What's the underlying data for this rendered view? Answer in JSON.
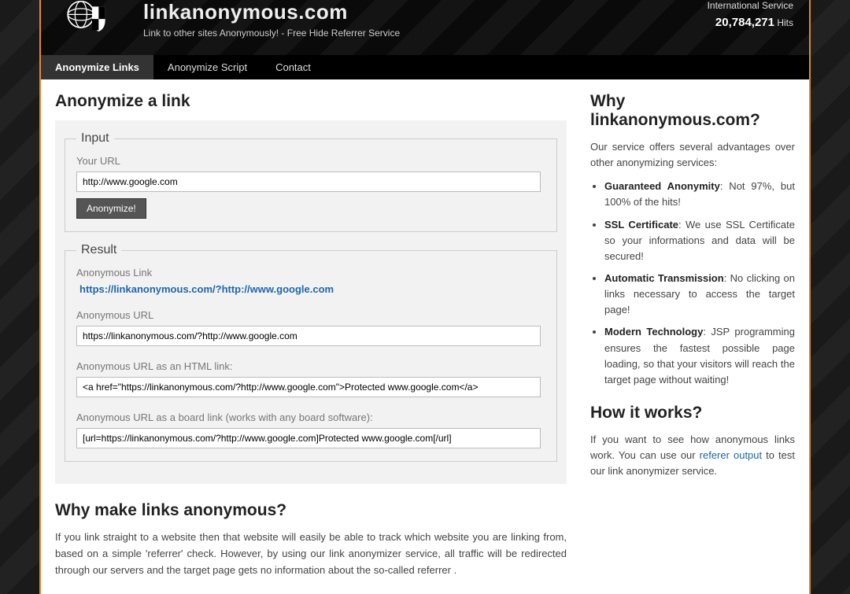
{
  "header": {
    "title": "linkanonymous.com",
    "tagline": "Link to other sites Anonymously! - Free Hide Referrer Service",
    "service_label": "International Service",
    "hits_count": "20,784,271",
    "hits_label": "Hits"
  },
  "nav": {
    "items": [
      {
        "label": "Anonymize Links",
        "active": true
      },
      {
        "label": "Anonymize Script",
        "active": false
      },
      {
        "label": "Contact",
        "active": false
      }
    ]
  },
  "main": {
    "heading": "Anonymize a link",
    "input_legend": "Input",
    "url_label": "Your URL",
    "url_value": "http://www.google.com",
    "submit_label": "Anonymize!",
    "result_legend": "Result",
    "anon_link_label": "Anonymous Link",
    "anon_link_value": "https://linkanonymous.com/?http://www.google.com",
    "anon_url_label": "Anonymous URL",
    "anon_url_value": "https://linkanonymous.com/?http://www.google.com",
    "anon_html_label": "Anonymous URL as an HTML link:",
    "anon_html_value": "<a href=\"https://linkanonymous.com/?http://www.google.com\">Protected www.google.com</a>",
    "anon_board_label": "Anonymous URL as a board link (works with any board software):",
    "anon_board_value": "[url=https://linkanonymous.com/?http://www.google.com]Protected www.google.com[/url]",
    "why_heading": "Why make links anonymous?",
    "why_text": "If you link straight to a website then that website will easily be able to track which website you are linking from, based on a simple 'referrer' check. However, by using our link anonymizer service, all traffic will be redirected through our servers and the target page gets no information about the so-called referrer ."
  },
  "sidebar": {
    "why_heading": "Why linkanonymous.com?",
    "why_intro": "Our service offers several advantages over other anonymizing services:",
    "advantages": [
      {
        "title": "Guaranteed Anonymity",
        "text": ": Not 97%, but 100% of the hits!"
      },
      {
        "title": "SSL Certificate",
        "text": ": We use SSL Certificate so your informations and data will be secured!"
      },
      {
        "title": "Automatic Transmission",
        "text": ": No clicking on links necessary to access the target page!"
      },
      {
        "title": "Modern Technology",
        "text": ": JSP programming ensures the fastest possible page loading, so that your visitors will reach the target page without waiting!"
      }
    ],
    "how_heading": "How it works?",
    "how_text_before": "If you want to see how anonymous links work. You can use our ",
    "how_link": "referer output",
    "how_text_after": " to test our link anonymizer service."
  }
}
